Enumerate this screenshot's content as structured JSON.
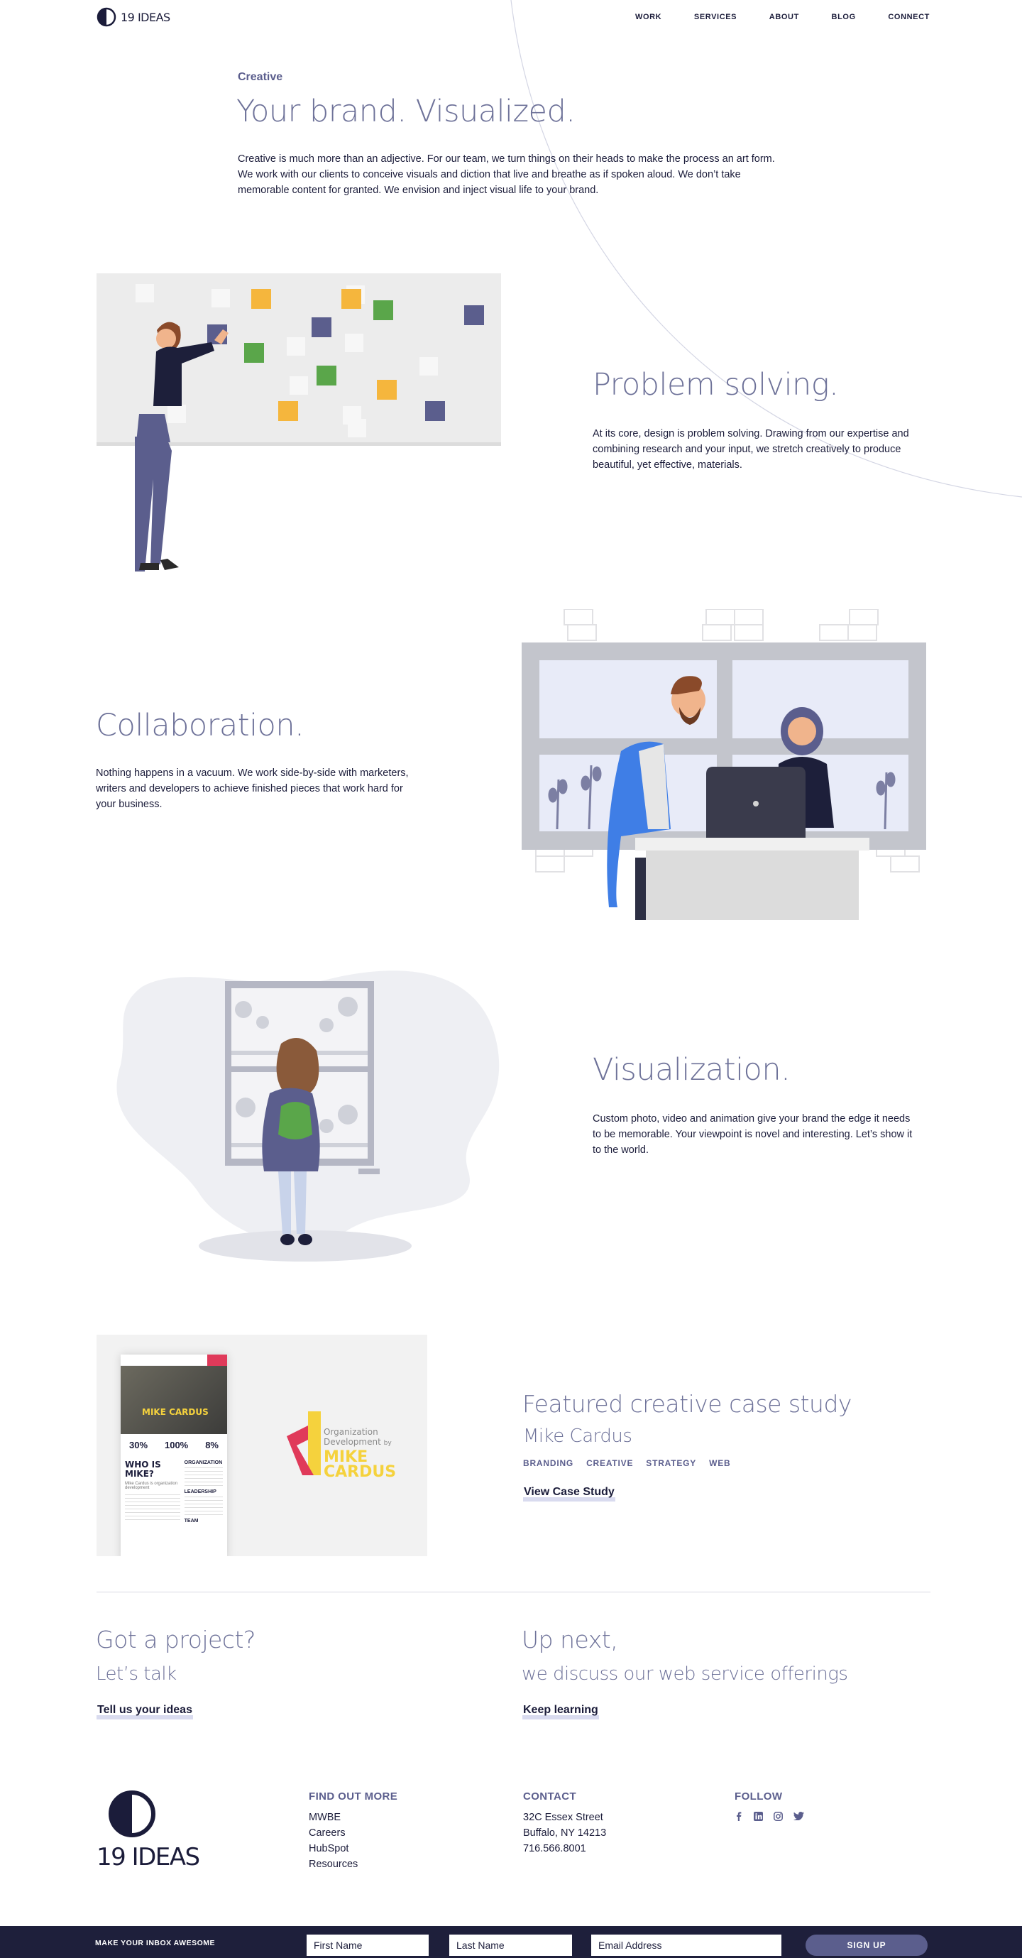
{
  "header": {
    "logo_text": "19 IDEAS",
    "nav": [
      "WORK",
      "SERVICES",
      "ABOUT",
      "BLOG",
      "CONNECT"
    ]
  },
  "intro": {
    "eyebrow": "Creative",
    "title": "Your brand. Visualized.",
    "text": "Creative is much more than an adjective. For our team, we turn things on their heads to make the process an art form. We work with our clients to conceive visuals and diction that live and breathe as if spoken aloud. We don’t take memorable content for granted. We envision and inject visual life to your brand."
  },
  "sections": [
    {
      "title": "Problem solving.",
      "text": "At its core, design is problem solving. Drawing from our expertise and combining research and your input, we stretch creatively to produce beautiful, yet effective, materials."
    },
    {
      "title": "Collaboration.",
      "text": "Nothing happens in a vacuum. We work side-by-side with marketers, writers and developers to achieve finished pieces that work hard for your business."
    },
    {
      "title": "Visualization.",
      "text": "Custom photo, video and animation give your brand the edge it needs to be memorable. Your viewpoint is novel and interesting. Let’s show it to the world."
    }
  ],
  "case_study": {
    "heading": "Featured creative case study",
    "client": "Mike Cardus",
    "tags": [
      "BRANDING",
      "CREATIVE",
      "STRATEGY",
      "WEB"
    ],
    "link": "View Case Study",
    "logo_line1": "Organization",
    "logo_line2": "Development",
    "logo_by": "by",
    "logo_name1": "MIKE",
    "logo_name2": "CARDUS",
    "mock": {
      "hero": "MIKE CARDUS",
      "stats": [
        "30%",
        "100%",
        "8%"
      ],
      "who": "WHO IS MIKE?",
      "sub": "Mike Cardus is organization development",
      "org": "ORGANIZATION",
      "lead": "LEADERSHIP",
      "team": "TEAM"
    }
  },
  "cta": {
    "left_title": "Got a project?",
    "left_sub": "Let’s talk",
    "left_link": "Tell us your ideas",
    "right_title": "Up next,",
    "right_sub": "we discuss our web service offerings",
    "right_link": "Keep learning"
  },
  "footer": {
    "logo_text": "19 IDEAS",
    "find_title": "FIND OUT MORE",
    "find_links": [
      "MWBE",
      "Careers",
      "HubSpot",
      "Resources"
    ],
    "contact_title": "CONTACT",
    "contact_lines": [
      "32C Essex Street",
      "Buffalo, NY 14213",
      "716.566.8001"
    ],
    "follow_title": "FOLLOW",
    "social_icons": [
      "facebook-icon",
      "linkedin-icon",
      "instagram-icon",
      "twitter-icon"
    ]
  },
  "newsletter": {
    "label": "MAKE YOUR INBOX AWESOME",
    "first_placeholder": "First Name",
    "last_placeholder": "Last Name",
    "email_placeholder": "Email Address",
    "button": "SIGN UP"
  },
  "colors": {
    "navy": "#1b1c3a",
    "accent": "#5b5e8d",
    "title_light": "#6e7299",
    "yellow": "#f5b63d",
    "green": "#5aa64a",
    "slate": "#5b5e8d",
    "blue": "#3f7ee6",
    "footer_bar": "#1e1f3b"
  }
}
